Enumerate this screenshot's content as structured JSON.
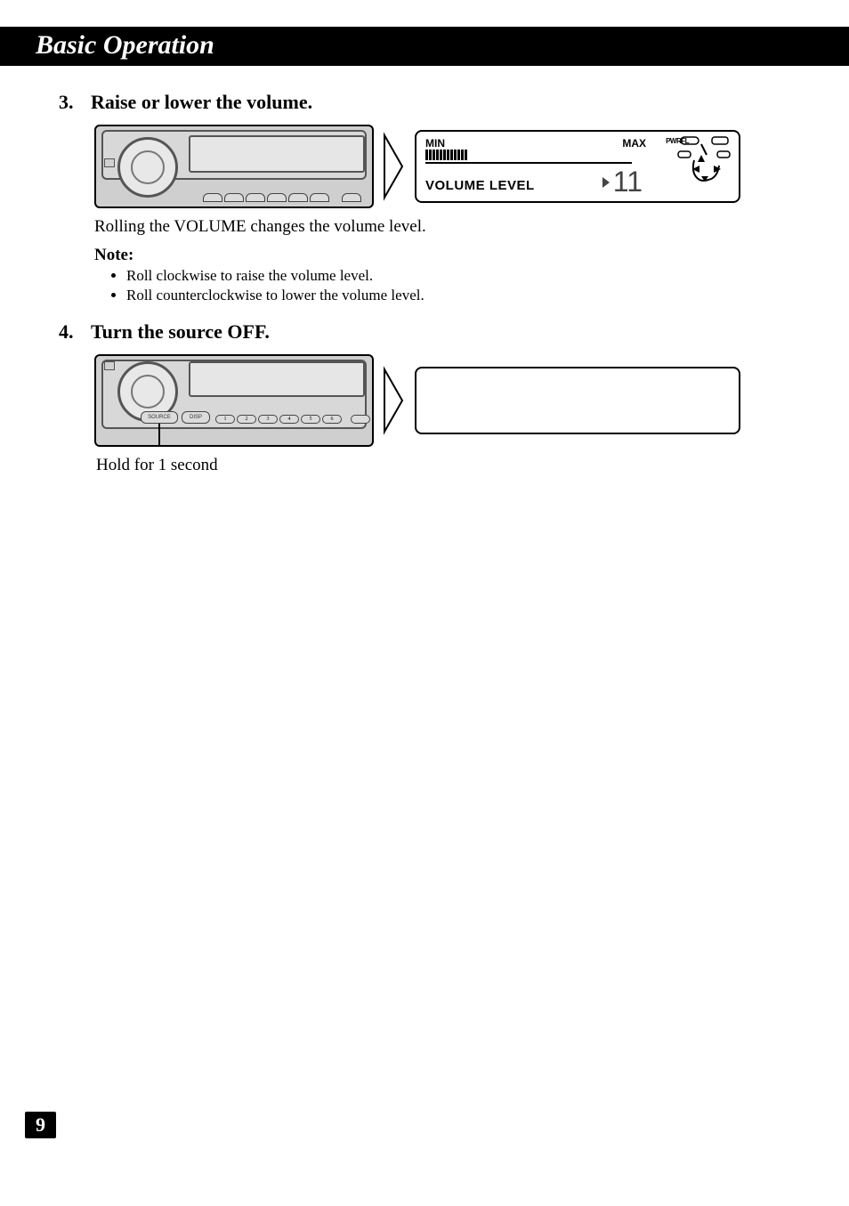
{
  "header": {
    "title": "Basic Operation"
  },
  "step3": {
    "number": "3.",
    "title": "Raise or lower the volume.",
    "display": {
      "min_label": "MIN",
      "max_label": "MAX",
      "volume_label": "VOLUME LEVEL",
      "volume_value": "11",
      "indicator": "PWRFL"
    },
    "body": "Rolling the VOLUME changes the volume level.",
    "note_heading": "Note:",
    "notes": [
      "Roll clockwise to raise the volume level.",
      "Roll counterclockwise to lower the volume level."
    ]
  },
  "step4": {
    "number": "4.",
    "title": "Turn the source OFF.",
    "buttons": {
      "source": "SOURCE",
      "disp": "DISP",
      "presets": [
        "1",
        "2",
        "3",
        "4",
        "5",
        "6"
      ]
    },
    "caption": "Hold for 1 second"
  },
  "page_number": "9"
}
